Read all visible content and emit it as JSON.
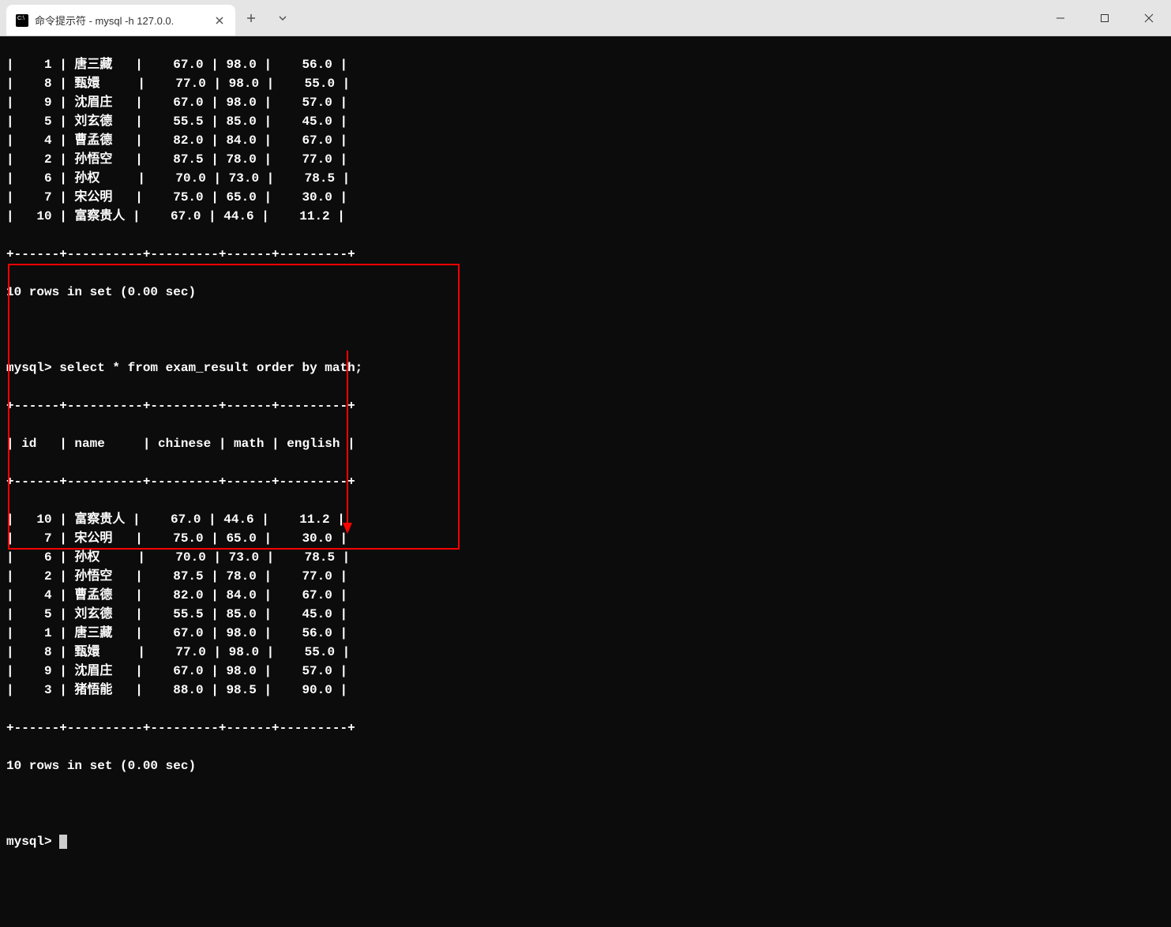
{
  "window": {
    "tab_title": "命令提示符 - mysql  -h 127.0.0."
  },
  "terminal": {
    "table1_rows": [
      {
        "id": "1",
        "name": "唐三藏",
        "chinese": "67.0",
        "math": "98.0",
        "english": "56.0"
      },
      {
        "id": "8",
        "name": "甄嬛",
        "chinese": "77.0",
        "math": "98.0",
        "english": "55.0"
      },
      {
        "id": "9",
        "name": "沈眉庄",
        "chinese": "67.0",
        "math": "98.0",
        "english": "57.0"
      },
      {
        "id": "5",
        "name": "刘玄德",
        "chinese": "55.5",
        "math": "85.0",
        "english": "45.0"
      },
      {
        "id": "4",
        "name": "曹孟德",
        "chinese": "82.0",
        "math": "84.0",
        "english": "67.0"
      },
      {
        "id": "2",
        "name": "孙悟空",
        "chinese": "87.5",
        "math": "78.0",
        "english": "77.0"
      },
      {
        "id": "6",
        "name": "孙权",
        "chinese": "70.0",
        "math": "73.0",
        "english": "78.5"
      },
      {
        "id": "7",
        "name": "宋公明",
        "chinese": "75.0",
        "math": "65.0",
        "english": "30.0"
      },
      {
        "id": "10",
        "name": "富察贵人",
        "chinese": "67.0",
        "math": "44.6",
        "english": "11.2"
      }
    ],
    "status1": "10 rows in set (0.00 sec)",
    "prompt_query": "mysql> select * from exam_result order by math;",
    "headers": {
      "id": "id",
      "name": "name",
      "chinese": "chinese",
      "math": "math",
      "english": "english"
    },
    "table2_rows": [
      {
        "id": "10",
        "name": "富察贵人",
        "chinese": "67.0",
        "math": "44.6",
        "english": "11.2"
      },
      {
        "id": "7",
        "name": "宋公明",
        "chinese": "75.0",
        "math": "65.0",
        "english": "30.0"
      },
      {
        "id": "6",
        "name": "孙权",
        "chinese": "70.0",
        "math": "73.0",
        "english": "78.5"
      },
      {
        "id": "2",
        "name": "孙悟空",
        "chinese": "87.5",
        "math": "78.0",
        "english": "77.0"
      },
      {
        "id": "4",
        "name": "曹孟德",
        "chinese": "82.0",
        "math": "84.0",
        "english": "67.0"
      },
      {
        "id": "5",
        "name": "刘玄德",
        "chinese": "55.5",
        "math": "85.0",
        "english": "45.0"
      },
      {
        "id": "1",
        "name": "唐三藏",
        "chinese": "67.0",
        "math": "98.0",
        "english": "56.0"
      },
      {
        "id": "8",
        "name": "甄嬛",
        "chinese": "77.0",
        "math": "98.0",
        "english": "55.0"
      },
      {
        "id": "9",
        "name": "沈眉庄",
        "chinese": "67.0",
        "math": "98.0",
        "english": "57.0"
      },
      {
        "id": "3",
        "name": "猪悟能",
        "chinese": "88.0",
        "math": "98.5",
        "english": "90.0"
      }
    ],
    "status2": "10 rows in set (0.00 sec)",
    "prompt2": "mysql>",
    "border": "+------+----------+---------+------+---------+"
  }
}
